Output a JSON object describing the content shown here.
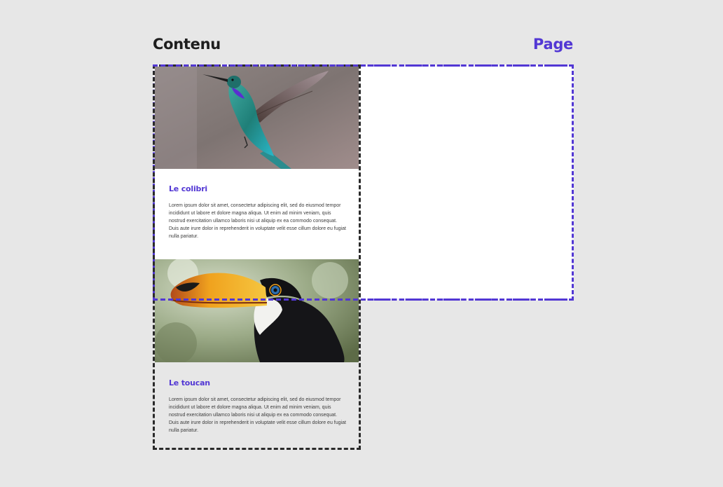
{
  "labels": {
    "content": "Contenu",
    "page": "Page"
  },
  "cards": [
    {
      "title": "Le colibri",
      "text": "Lorem ipsum dolor sit amet, consectetur adipiscing elit, sed do eiusmod tempor incididunt ut labore et dolore magna aliqua. Ut enim ad minim veniam, quis nostrud exercitation ullamco laboris nisi ut aliquip ex ea commodo consequat. Duis aute irure dolor in reprehenderit in voluptate velit esse cillum dolore eu fugiat nulla pariatur."
    },
    {
      "title": "Le toucan",
      "text": "Lorem ipsum dolor sit amet, consectetur adipiscing elit, sed do eiusmod tempor incididunt ut labore et dolore magna aliqua. Ut enim ad minim veniam, quis nostrud exercitation ullamco laboris nisi ut aliquip ex ea commodo consequat. Duis aute irure dolor in reprehenderit in voluptate velit esse cillum dolore eu fugiat nulla pariatur."
    }
  ],
  "colors": {
    "accent": "#5237d4",
    "content_border": "#2a2a2a",
    "background": "#e7e7e7"
  }
}
